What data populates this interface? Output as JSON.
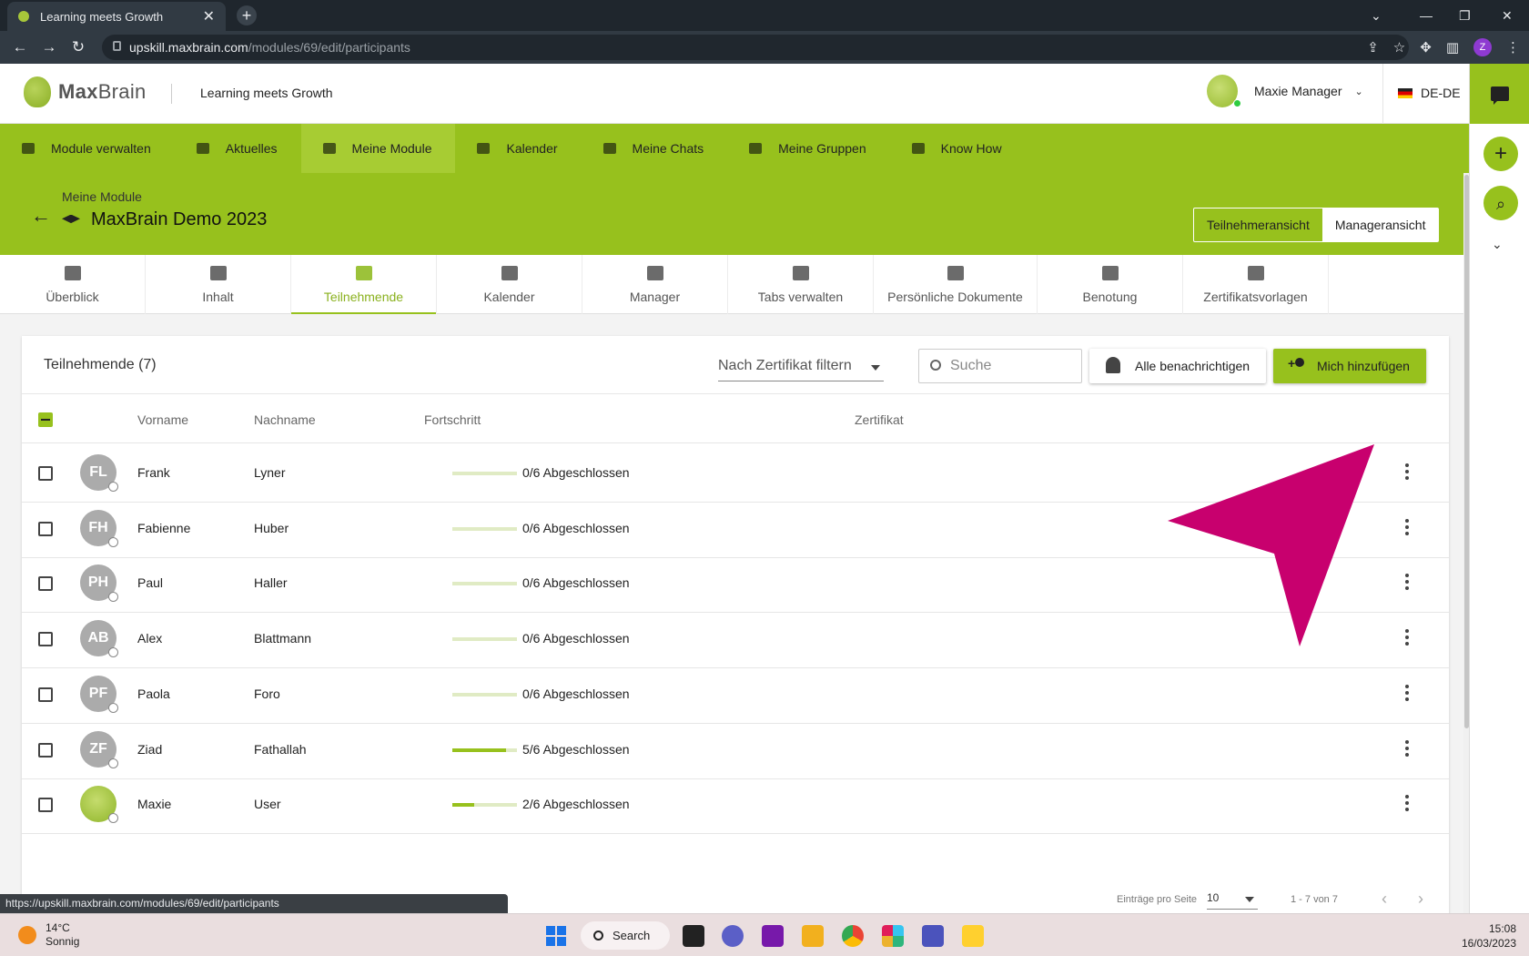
{
  "browser": {
    "tab_title": "Learning meets Growth",
    "url_host": "upskill.maxbrain.com",
    "url_path": "/modules/69/edit/participants",
    "profile_initial": "Z",
    "status_url": "https://upskill.maxbrain.com/modules/69/edit/participants"
  },
  "header": {
    "logo_bold": "Max",
    "logo_light": "Brain",
    "tagline": "Learning meets Growth",
    "user_name": "Maxie Manager",
    "language": "DE-DE"
  },
  "main_nav": [
    {
      "label": "Module verwalten",
      "icon": "briefcase-icon"
    },
    {
      "label": "Aktuelles",
      "icon": "news-icon"
    },
    {
      "label": "Meine Module",
      "icon": "graduation-cap-icon",
      "active": true
    },
    {
      "label": "Kalender",
      "icon": "calendar-icon"
    },
    {
      "label": "Meine Chats",
      "icon": "chat-icon"
    },
    {
      "label": "Meine Gruppen",
      "icon": "group-icon"
    },
    {
      "label": "Know How",
      "icon": "book-icon"
    }
  ],
  "page": {
    "breadcrumb": "Meine Module",
    "title": "MaxBrain Demo 2023",
    "view_participant": "Teilnehmeransicht",
    "view_manager": "Manageransicht"
  },
  "sub_tabs": [
    {
      "label": "Überblick",
      "icon": "dashboard-icon"
    },
    {
      "label": "Inhalt",
      "icon": "folder-icon"
    },
    {
      "label": "Teilnehmende",
      "icon": "people-icon",
      "active": true
    },
    {
      "label": "Kalender",
      "icon": "calendar-icon"
    },
    {
      "label": "Manager",
      "icon": "people-icon"
    },
    {
      "label": "Tabs verwalten",
      "icon": "window-icon"
    },
    {
      "label": "Persönliche Dokumente",
      "icon": "person-document-icon"
    },
    {
      "label": "Benotung",
      "icon": "grade-document-icon"
    },
    {
      "label": "Zertifikatsvorlagen",
      "icon": "certificate-settings-icon"
    }
  ],
  "participants": {
    "title": "Teilnehmende (7)",
    "filter_placeholder": "Nach Zertifikat filtern",
    "search_placeholder": "Suche",
    "notify_label": "Alle benachrichtigen",
    "add_me_label": "Mich hinzufügen",
    "columns": {
      "first_name": "Vorname",
      "last_name": "Nachname",
      "progress": "Fortschritt",
      "certificate": "Zertifikat"
    },
    "rows": [
      {
        "initials": "FL",
        "first": "Frank",
        "last": "Lyner",
        "progress_text": "0/6 Abgeschlossen",
        "progress": 0
      },
      {
        "initials": "FH",
        "first": "Fabienne",
        "last": "Huber",
        "progress_text": "0/6 Abgeschlossen",
        "progress": 0
      },
      {
        "initials": "PH",
        "first": "Paul",
        "last": "Haller",
        "progress_text": "0/6 Abgeschlossen",
        "progress": 0
      },
      {
        "initials": "AB",
        "first": "Alex",
        "last": "Blattmann",
        "progress_text": "0/6 Abgeschlossen",
        "progress": 0
      },
      {
        "initials": "PF",
        "first": "Paola",
        "last": "Foro",
        "progress_text": "0/6 Abgeschlossen",
        "progress": 0
      },
      {
        "initials": "ZF",
        "first": "Ziad",
        "last": "Fathallah",
        "progress_text": "5/6 Abgeschlossen",
        "progress": 0.833
      },
      {
        "initials": "",
        "first": "Maxie",
        "last": "User",
        "progress_text": "2/6 Abgeschlossen",
        "progress": 0.333,
        "brain_avatar": true
      }
    ],
    "pager": {
      "per_page_label": "Einträge pro Seite",
      "per_page": "10",
      "range": "1 - 7 von 7"
    }
  },
  "taskbar": {
    "temperature": "14°C",
    "weather": "Sonnig",
    "search": "Search",
    "time": "15:08",
    "date": "16/03/2023"
  },
  "colors": {
    "brand_green": "#97c11d",
    "annotation_arrow": "#c8006e"
  }
}
